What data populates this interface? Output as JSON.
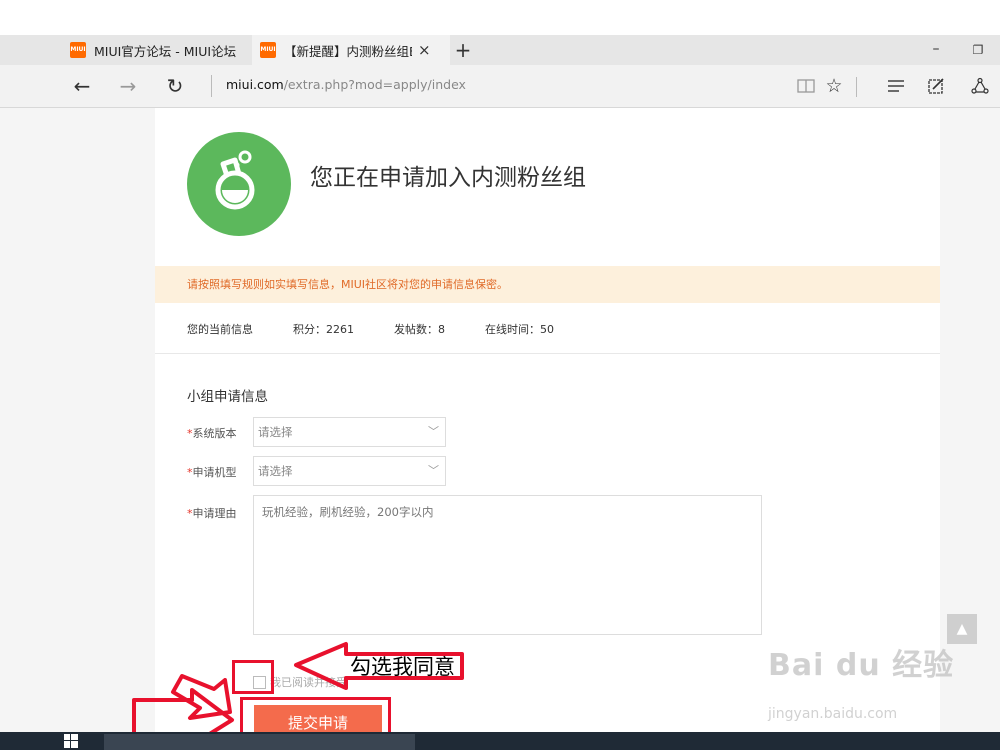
{
  "browser": {
    "tabs": [
      {
        "favicon_text": "MIUI",
        "title": "MIUI官方论坛 - MIUI论坛"
      },
      {
        "favicon_text": "MIUI",
        "title": "【新提醒】内测粉丝组E",
        "close": "×"
      }
    ],
    "new_tab": "+",
    "window_minimize": "–",
    "window_restore": "❐",
    "nav": {
      "back": "←",
      "forward": "→",
      "refresh": "↻"
    },
    "url_host": "miui.com",
    "url_path": "/extra.php?mod=apply/index",
    "toolbar_icons": [
      "reading-view-icon",
      "favorite-star-icon",
      "hub-icon",
      "web-note-icon",
      "share-icon"
    ]
  },
  "page": {
    "title": "您正在申请加入内测粉丝组",
    "notice": "请按照填写规则如实填写信息，MIUI社区将对您的申请信息保密。",
    "user_info": {
      "label": "您的当前信息",
      "points": "积分：2261",
      "posts": "发帖数：8",
      "online": "在线时间：50"
    },
    "section_title": "小组申请信息",
    "fields": {
      "system_version": {
        "label": "系统版本",
        "value": "请选择"
      },
      "device_model": {
        "label": "申请机型",
        "value": "请选择"
      },
      "reason": {
        "label": "申请理由",
        "placeholder": "玩机经验，刷机经验，200字以内"
      }
    },
    "required_mark": "*",
    "agree_text": "我已阅读并接受",
    "submit": "提交申请",
    "back_to_top": "▲"
  },
  "annotation": {
    "text": "勾选我同意",
    "color": "#e8112d"
  },
  "watermark": {
    "brand": "Bai du 经验",
    "site": "jingyan.baidu.com"
  },
  "colors": {
    "accent_green": "#5cb85c",
    "notice_bg": "#fdf0dc",
    "notice_text": "#e06a28",
    "submit_bg": "#f46b4c"
  }
}
